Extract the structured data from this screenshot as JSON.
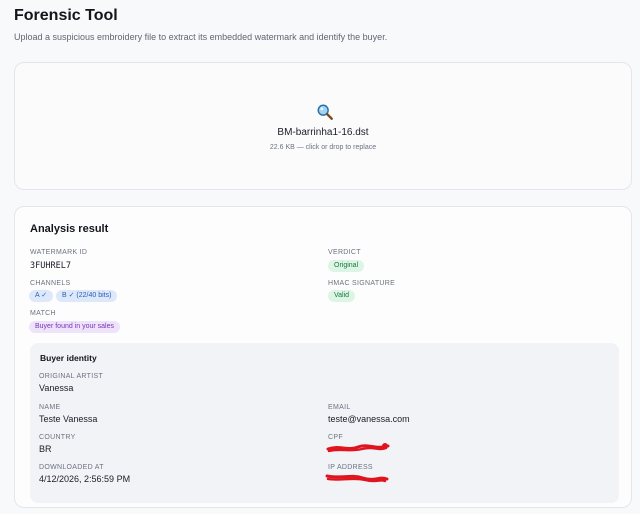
{
  "header": {
    "title": "Forensic Tool",
    "subtitle": "Upload a suspicious embroidery file to extract its embedded watermark and identify the buyer."
  },
  "upload": {
    "icon": "magnifier-icon",
    "filename": "BM-barrinha1-16.dst",
    "hint": "22.6 KB — click or drop to replace"
  },
  "result": {
    "title": "Analysis result",
    "watermark_label": "WATERMARK ID",
    "watermark_value": "3FUHREL7",
    "channels_label": "CHANNELS",
    "channel_a": "A ✓",
    "channel_b": "B ✓ (22/40 bits)",
    "match_label": "MATCH",
    "match_value": "Buyer found in your sales",
    "verdict_label": "VERDICT",
    "verdict_value": "Original",
    "hmac_label": "HMAC SIGNATURE",
    "hmac_value": "Valid"
  },
  "buyer": {
    "title": "Buyer identity",
    "artist_label": "ORIGINAL ARTIST",
    "artist_value": "Vanessa",
    "name_label": "NAME",
    "name_value": "Teste Vanessa",
    "email_label": "EMAIL",
    "email_value": "teste@vanessa.com",
    "country_label": "COUNTRY",
    "country_value": "BR",
    "cpf_label": "CPF",
    "downloaded_label": "DOWNLOADED AT",
    "downloaded_value": "4/12/2026, 2:56:59 PM",
    "ip_label": "IP ADDRESS"
  },
  "colors": {
    "verdict_pill": "#dcf5e5",
    "channel_pill": "#dde9fb",
    "match_pill": "#efe3fb",
    "redaction": "#e0141e"
  }
}
